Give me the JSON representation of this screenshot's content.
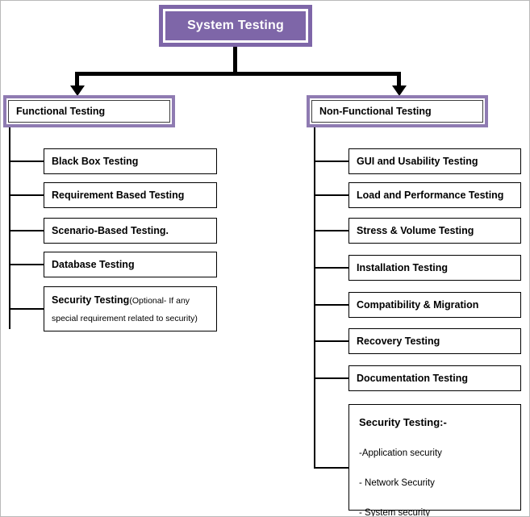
{
  "diagram": {
    "title": "System Testing",
    "root": {
      "label": "System Testing"
    },
    "branches": [
      {
        "label": "Functional Testing",
        "items": [
          {
            "label": "Black Box Testing"
          },
          {
            "label": "Requirement Based Testing"
          },
          {
            "label": "Scenario-Based Testing."
          },
          {
            "label": "Database Testing"
          }
        ],
        "note_box": {
          "heading": "Security Testing",
          "note_line1": "(Optional- If any",
          "note_line2": "special requirement related to security)"
        }
      },
      {
        "label": "Non-Functional  Testing",
        "items": [
          {
            "label": "GUI and Usability Testing"
          },
          {
            "label": "Load and Performance Testing"
          },
          {
            "label": "Stress & Volume Testing"
          },
          {
            "label": "Installation Testing"
          },
          {
            "label": "Compatibility & Migration"
          },
          {
            "label": "Recovery Testing"
          },
          {
            "label": "Documentation Testing"
          }
        ],
        "note_box": {
          "heading": "Security Testing:-",
          "lines": [
            "-Application security",
            "- Network Security",
            "- System security"
          ]
        }
      }
    ],
    "colors": {
      "root_fill": "#7E66A8",
      "branch_border": "#8F7BB2",
      "connector": "#000000",
      "box_border": "#000000",
      "text": "#000000",
      "root_text": "#FFFFFF"
    }
  }
}
